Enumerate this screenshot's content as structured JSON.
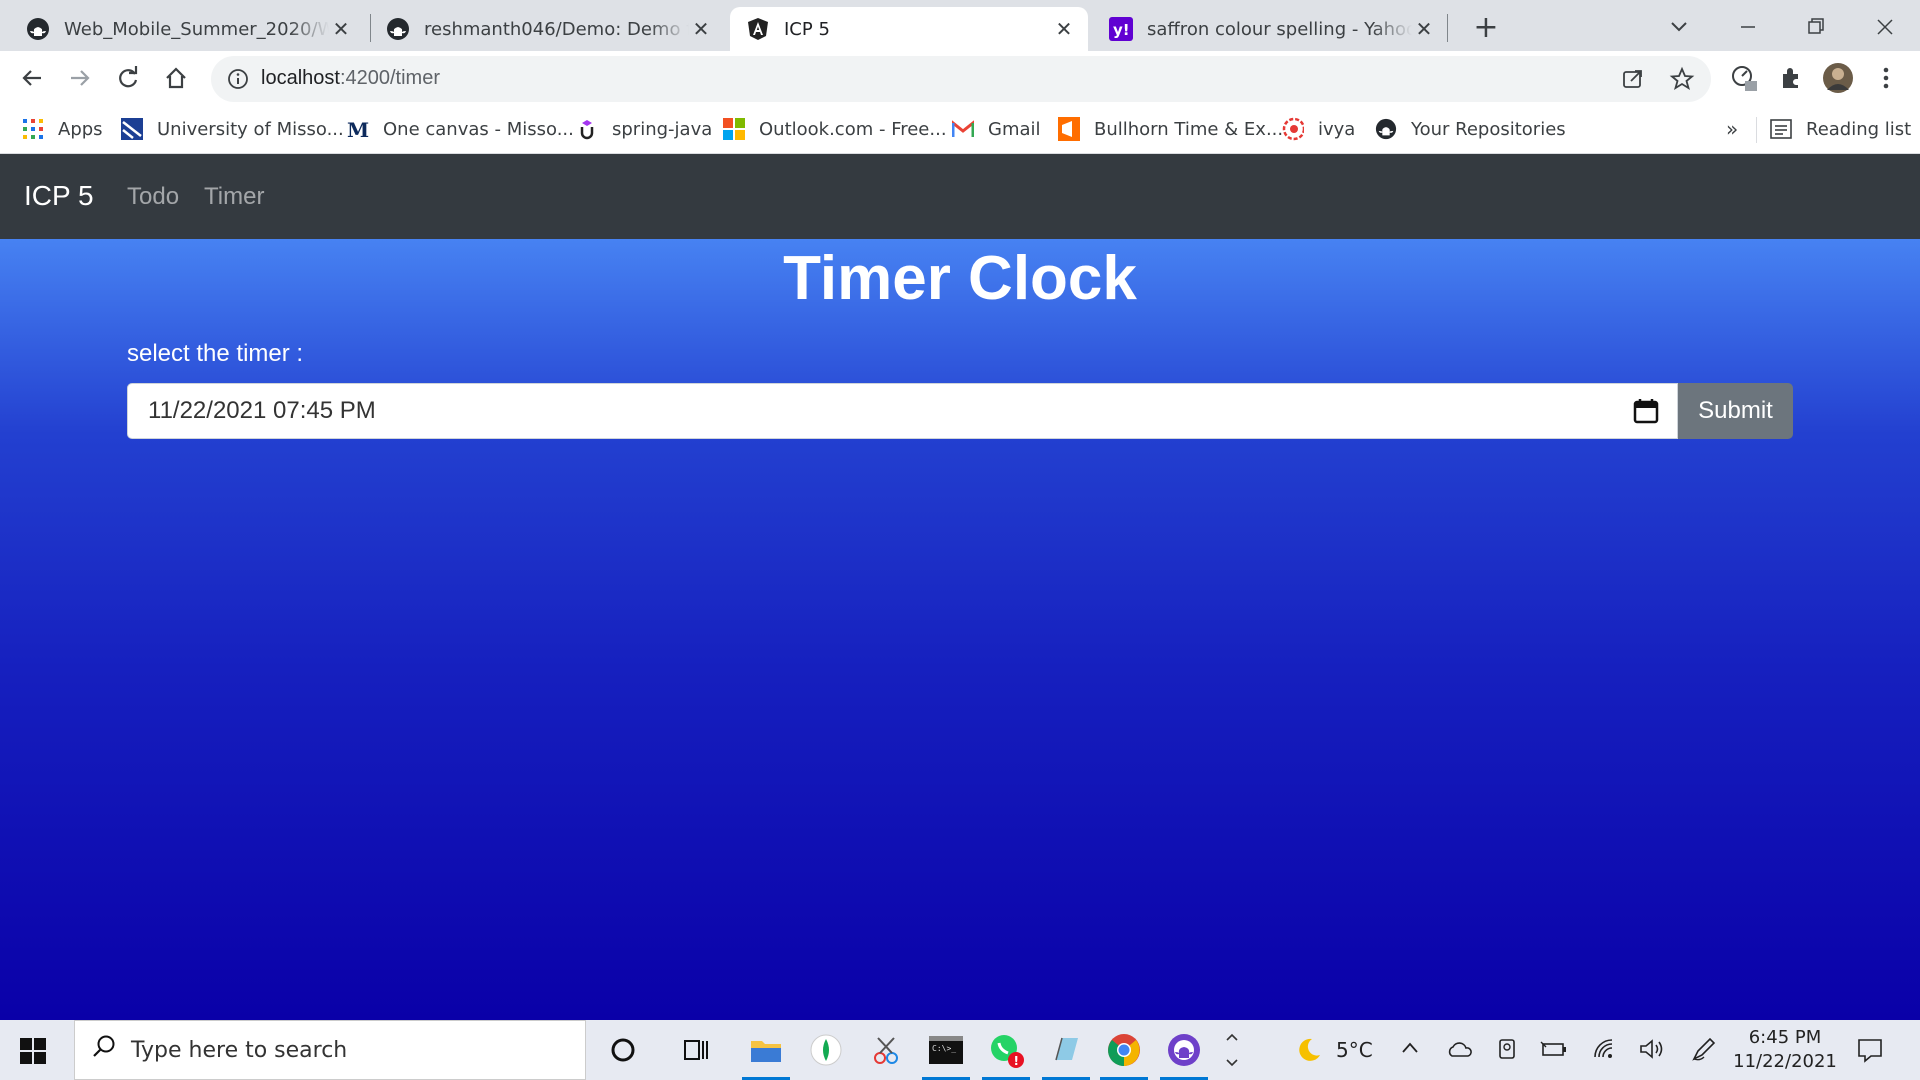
{
  "browser": {
    "tabs": [
      {
        "title": "Web_Mobile_Summer_2020/Web_Mobile_Summer_2020",
        "icon": "github-icon",
        "active": false
      },
      {
        "title": "reshmanth046/Demo: Demo for class",
        "icon": "github-icon",
        "active": false
      },
      {
        "title": "ICP 5",
        "icon": "angular-icon",
        "active": true
      },
      {
        "title": "saffron colour spelling - Yahoo Search",
        "icon": "yahoo-icon",
        "active": false
      }
    ],
    "new_tab_label": "+",
    "url_host": "localhost",
    "url_path": ":4200/timer",
    "bookmarks": [
      {
        "label": "Apps",
        "icon": "apps-grid-icon"
      },
      {
        "label": "University of Misso...",
        "icon": "university-icon"
      },
      {
        "label": "One canvas - Misso...",
        "icon": "canvas-icon"
      },
      {
        "label": "spring-java",
        "icon": "udemy-icon"
      },
      {
        "label": "Outlook.com - Free...",
        "icon": "microsoft-icon"
      },
      {
        "label": "Gmail",
        "icon": "gmail-icon"
      },
      {
        "label": "Bullhorn Time & Ex...",
        "icon": "bullhorn-icon"
      },
      {
        "label": "ivya",
        "icon": "ivya-icon"
      },
      {
        "label": "Your Repositories",
        "icon": "github-icon"
      }
    ],
    "bookmarks_overflow": "»",
    "reading_list": "Reading list"
  },
  "navbar": {
    "brand": "ICP 5",
    "links": [
      "Todo",
      "Timer"
    ]
  },
  "main": {
    "title": "Timer Clock",
    "select_label": "select the timer :",
    "datetime_value": "11/22/2021 07:45 PM",
    "submit_label": "Submit"
  },
  "taskbar": {
    "search_placeholder": "Type here to search",
    "weather": "5°C",
    "time": "6:45 PM",
    "date": "11/22/2021"
  },
  "colors": {
    "navbar": "#343a40",
    "gradient_top": "#4782f2",
    "gradient_bottom": "#0a00a8",
    "submit": "#6c757d"
  }
}
